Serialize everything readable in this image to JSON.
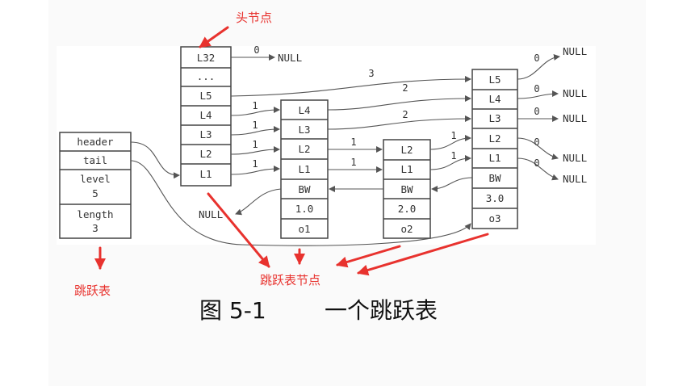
{
  "annotations": {
    "head_node": "头节点",
    "skiplist": "跳跃表",
    "skiplist_node": "跳跃表节点"
  },
  "caption": {
    "figure_no": "图 5-1",
    "title": "一个跳跃表"
  },
  "skiplist_struct": {
    "header": "header",
    "tail": "tail",
    "level_label": "level",
    "level_value": "5",
    "length_label": "length",
    "length_value": "3"
  },
  "head_node": {
    "levels": [
      "L32",
      "...",
      "L5",
      "L4",
      "L3",
      "L2",
      "L1"
    ]
  },
  "node1": {
    "levels": [
      "L4",
      "L3",
      "L2",
      "L1"
    ],
    "backward": "BW",
    "score": "1.0",
    "obj": "o1"
  },
  "node2": {
    "levels": [
      "L2",
      "L1"
    ],
    "backward": "BW",
    "score": "2.0",
    "obj": "o2"
  },
  "node3": {
    "levels": [
      "L5",
      "L4",
      "L3",
      "L2",
      "L1"
    ],
    "backward": "BW",
    "score": "3.0",
    "obj": "o3"
  },
  "edges": {
    "head_l32_span": "0",
    "head_l5_span": "3",
    "head_l4_span": "1",
    "head_l3_span": "1",
    "head_l2_span": "1",
    "head_l1_span": "1",
    "n1_l4_span": "2",
    "n1_l3_span": "2",
    "n1_l2_span": "1",
    "n1_l1_span": "1",
    "n2_l2_span": "1",
    "n2_l1_span": "1",
    "n3_l5_span": "0",
    "n3_l4_span": "0",
    "n3_l3_span": "0",
    "n3_l2_span": "0",
    "n3_l1_span": "0",
    "null_text": "NULL"
  },
  "colors": {
    "annotation_red": "#e8322e",
    "box_stroke": "#444444",
    "arrow_gray": "#555555"
  }
}
